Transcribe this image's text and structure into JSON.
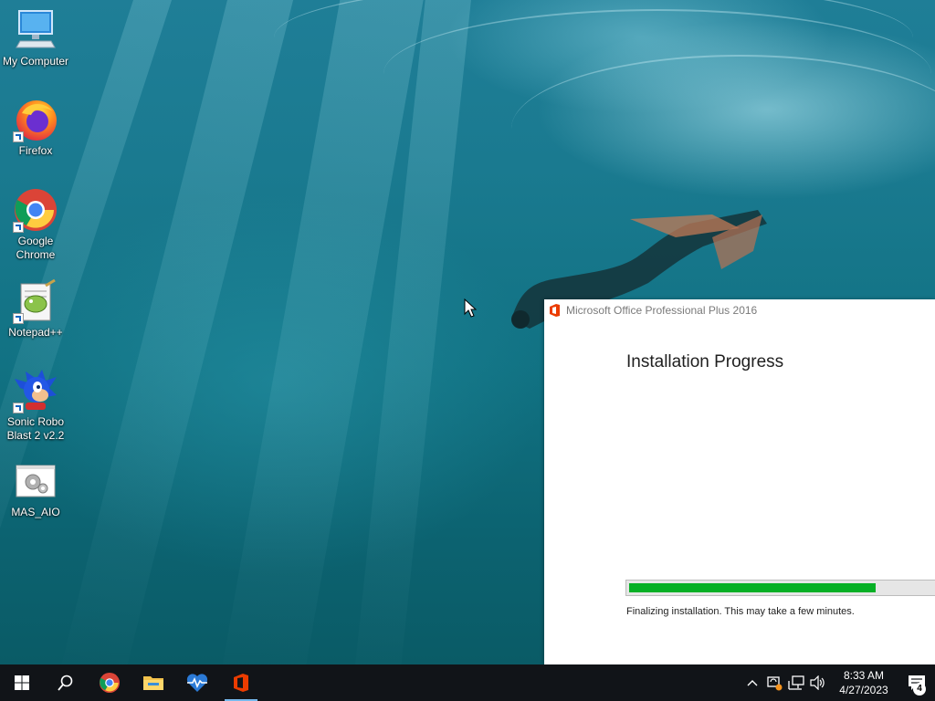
{
  "desktop": {
    "icons": [
      {
        "label": "My Computer",
        "icon": "computer-icon"
      },
      {
        "label": "Firefox",
        "icon": "firefox-icon"
      },
      {
        "label": "Google Chrome",
        "icon": "chrome-icon"
      },
      {
        "label": "Notepad++",
        "icon": "notepadpp-icon"
      },
      {
        "label": "Sonic Robo Blast 2 v2.2",
        "icon": "sonic-icon"
      },
      {
        "label": "MAS_AIO",
        "icon": "batch-file-icon"
      }
    ]
  },
  "office_window": {
    "title": "Microsoft Office Professional Plus 2016",
    "heading": "Installation Progress",
    "progress_fraction": 0.8,
    "status": "Finalizing installation. This may take a few minutes.",
    "progress_color": "#06b025",
    "brand_color": "#eb3c00"
  },
  "taskbar": {
    "apps": [
      "start-icon",
      "search-icon",
      "chrome-icon",
      "file-explorer-icon",
      "health-monitor-icon",
      "office-icon"
    ],
    "active_app": "office-icon",
    "clock": {
      "time": "8:33 AM",
      "date": "4/27/2023"
    },
    "notification_count": "4"
  }
}
